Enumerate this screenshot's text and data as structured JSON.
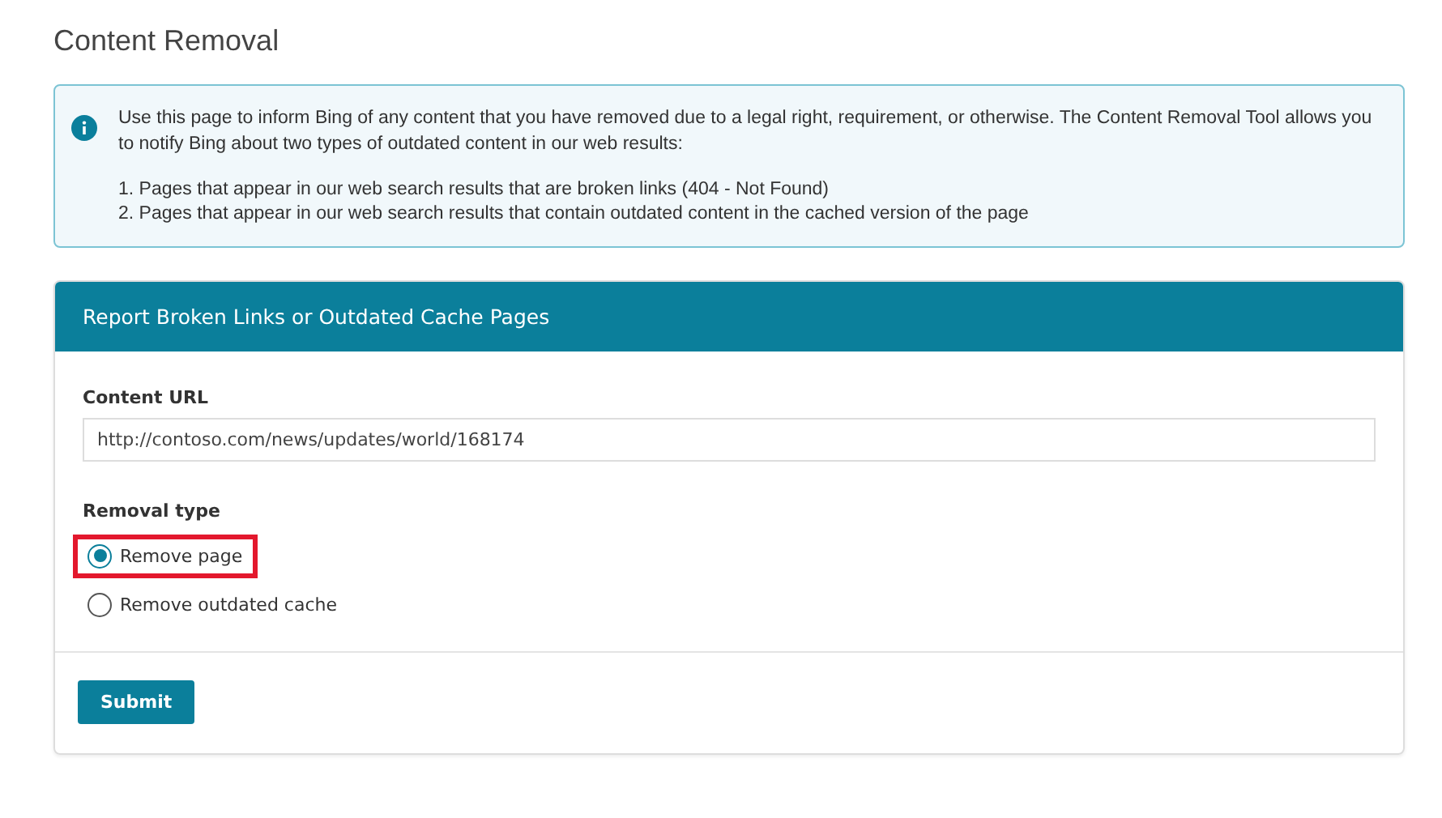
{
  "page_title": "Content Removal",
  "info": {
    "text": "Use this page to inform Bing of any content that you have removed due to a legal right, requirement, or otherwise. The Content Removal Tool allows you to notify Bing about two types of outdated content in our web results:",
    "list": [
      "1. Pages that appear in our web search results that are broken links (404 - Not Found)",
      "2. Pages that appear in our web search results that contain outdated content in the cached version of the page"
    ]
  },
  "form": {
    "header": "Report Broken Links or Outdated Cache Pages",
    "url_label": "Content URL",
    "url_value": "http://contoso.com/news/updates/world/168174",
    "type_label": "Removal type",
    "options": [
      {
        "label": "Remove page",
        "selected": true,
        "highlighted": true
      },
      {
        "label": "Remove outdated cache",
        "selected": false,
        "highlighted": false
      }
    ],
    "submit": "Submit"
  }
}
